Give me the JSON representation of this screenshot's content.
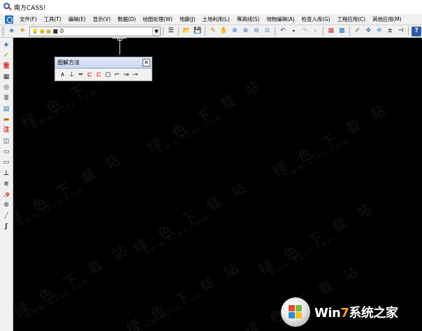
{
  "window": {
    "title": "南方CASS!"
  },
  "menu": {
    "items": [
      "文件(F)",
      "工具(T)",
      "编辑(E)",
      "显示(V)",
      "数据(D)",
      "绘图处理(W)",
      "地籍(J)",
      "土地利用(L)",
      "等高线(S)",
      "地物编辑(A)",
      "检查入库(G)",
      "工程应用(C)",
      "其他应用(M)"
    ]
  },
  "toolbar": {
    "layer_value": "0",
    "icons": [
      "layers-icon",
      "layer-state-icon",
      "bulb-icon",
      "sun-icon",
      "lock-icon",
      "color-square-icon",
      "linetype-icon",
      "open-folder-icon",
      "save-icon",
      "pencil-icon",
      "zoom-realtime-icon",
      "zoom-window-icon",
      "zoom-in-icon",
      "zoom-out-icon",
      "zoom-previous-icon",
      "undo-icon",
      "redo-icon",
      "properties-icon",
      "grid-icon",
      "edit-pen-icon",
      "move-icon",
      "snap-icon",
      "offset-icon",
      "help-icon"
    ]
  },
  "left_toolbar": {
    "icons": [
      "layer-tool-icon",
      "check-mark-icon",
      "weight-icon",
      "matrix-icon",
      "circle-point-icon",
      "blocks-icon",
      "terrain-icon",
      "grid-lines-icon",
      "note-icon",
      "rect-dash-icon",
      "rectangle-icon",
      "hatch-icon",
      "dimension-icon",
      "stairs-icon",
      "elevation-icon",
      "target-icon",
      "line-icon",
      "curve-icon"
    ]
  },
  "palette": {
    "title": "图解方法",
    "tools": [
      "angle-line-icon",
      "perpendicular-icon",
      "parallel-icon",
      "bracket-left-icon",
      "bracket-right-icon",
      "rectangle-corner-icon",
      "step-icon",
      "bend-icon",
      "offset-line-icon"
    ]
  },
  "watermark": {
    "cn": "绿 色 下 载 站",
    "en": "www.42xz.com"
  },
  "badge": {
    "win": "Win",
    "seven": "7",
    "rest": "系统之家"
  },
  "colors": {
    "canvas": "#000000",
    "menu_bg": "#f0f0f0",
    "badge_accent": "#ff9a18"
  }
}
